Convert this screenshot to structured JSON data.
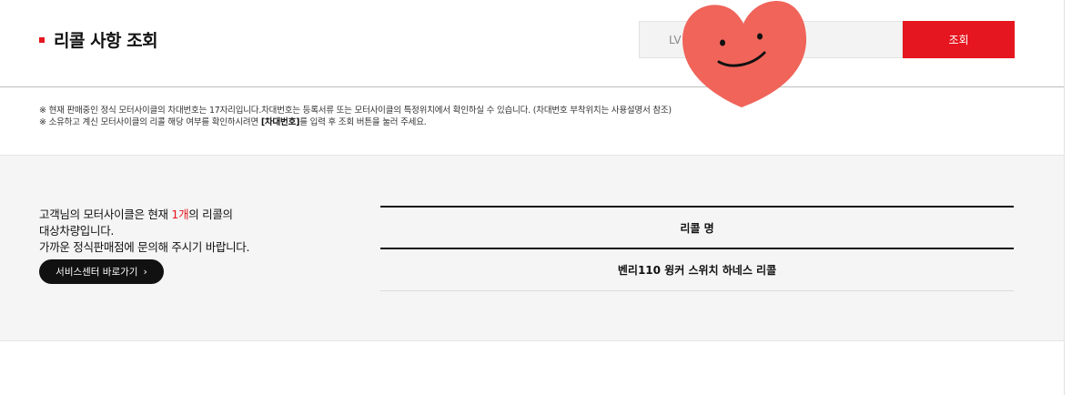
{
  "header": {
    "title": "리콜 사항 조회",
    "search_value": "LV",
    "search_button": "조회"
  },
  "notes": [
    {
      "pre": "※ 현재 판매중인 정식 모터사이클의 차대번호는 17자리입니다.차대번호는 등록서류 또는 모터사이클의 특정위치에서 확인하실 수 있습니다. (차대번호 부착위치는 사용설명서 참조)",
      "bold": "",
      "post": ""
    },
    {
      "pre": "※ 소유하고 계신 모터사이클의 리콜 해당 여부를 확인하시려면 ",
      "bold": "[차대번호]",
      "post": "를 입력 후 조회 버튼을 눌러 주세요."
    }
  ],
  "result": {
    "message_pre": "고객님의 모터사이클은 현재 ",
    "count": "1개",
    "message_post": "의 리콜의",
    "message_line2": "대상차량입니다.",
    "message_line3": "가까운 정식판매점에 문의해 주시기 바랍니다.",
    "service_button": "서비스센터 바로가기",
    "service_icon": "chevron-right-icon"
  },
  "table": {
    "column_header": "리콜 명",
    "rows": [
      "벤리110 윙커 스위치 하네스 리콜"
    ]
  },
  "colors": {
    "accent": "#e5161f",
    "sticker": "#f0645a"
  }
}
